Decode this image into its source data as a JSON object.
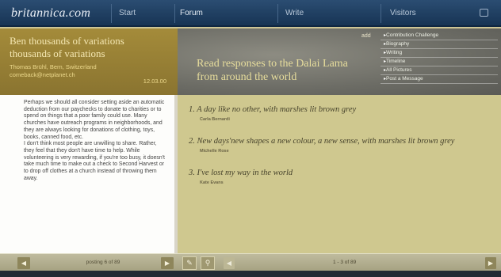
{
  "topbar": {
    "logo": "britannica.com",
    "nav": [
      "Start",
      "Forum",
      "Write",
      "Visitors"
    ]
  },
  "topic": {
    "title": "Ben thousands of variations thousands of variations",
    "meta": "Thomas Brühl, Bern, Switzerland comeback@netplanet.ch",
    "time": "12.03.00"
  },
  "post": {
    "text": "Perhaps we should all consider setting aside an automatic deduction from our paychecks to donate to charities or to spend on things that a poor family could use. Many churches have outreach programs in neighborhoods, and they are always looking for donations of clothing, toys, books, canned food, etc.\nI don't think most people are unwilling to share. Rather, they feel that they don't have time to help. While volunteering is very rewarding, if you're too busy, it doesn't take much time to make out a check to Second Harvest or to drop off clothes at a church instead of throwing them away."
  },
  "hero": {
    "title": "Read responses to the Dalai Lama from around the world",
    "add_label": "add",
    "menu": [
      "Contribution Challenge",
      "Biography",
      "Writing",
      "Timeline",
      "All Pictures",
      "Post a Message"
    ]
  },
  "responses": [
    {
      "text": "1. A day like no other, with marshes lit brown grey",
      "author": "Carla Bernardi"
    },
    {
      "text": "2. New days'new shapes a new colour, a new sense, with marshes lit brown grey",
      "author": "Michelle Rose"
    },
    {
      "text": "3. I've lost my way in the world",
      "author": "Kate Evans"
    }
  ],
  "bottombar": {
    "posting_count": "posting 6 of 89",
    "response_count": "1 - 3 of 89"
  },
  "colors": {
    "accent": "#8d7530",
    "nav": "#1f3f63",
    "main_bg": "#cfc88f"
  }
}
